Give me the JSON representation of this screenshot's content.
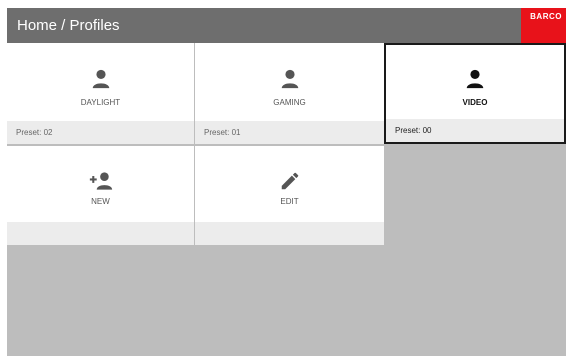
{
  "header": {
    "title": "Home / Profiles",
    "brand": "BARCO",
    "background_color": "#6e6e6e",
    "brand_color": "#e8121a"
  },
  "profiles": [
    {
      "label": "DAYLIGHT",
      "preset": "Preset: 02",
      "icon": "person-icon",
      "selected": false
    },
    {
      "label": "GAMING",
      "preset": "Preset: 01",
      "icon": "person-icon",
      "selected": false
    },
    {
      "label": "VIDEO",
      "preset": "Preset: 00",
      "icon": "person-icon",
      "selected": true
    }
  ],
  "actions": [
    {
      "label": "NEW",
      "icon": "add-person-icon"
    },
    {
      "label": "EDIT",
      "icon": "pencil-icon"
    }
  ]
}
